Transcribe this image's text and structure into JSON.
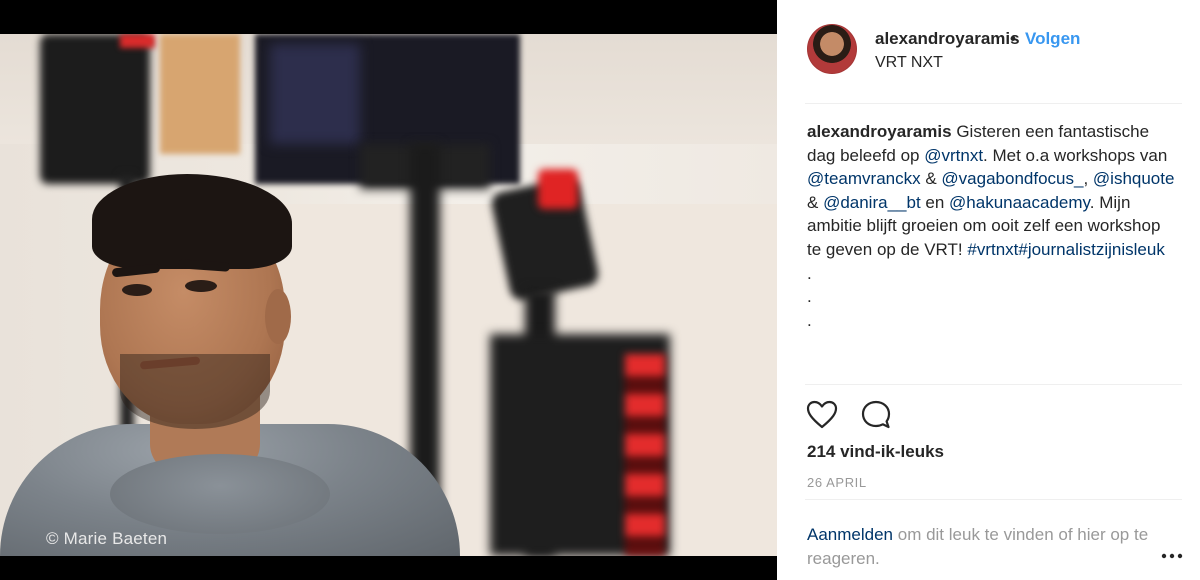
{
  "photo": {
    "credit": "© Marie Baeten"
  },
  "header": {
    "username": "alexandroyaramis",
    "separator": "•",
    "follow_label": "Volgen",
    "location": "VRT NXT",
    "avatar_icon": "user-avatar"
  },
  "caption": {
    "username": "alexandroyaramis",
    "parts": [
      " Gisteren een fantastische dag beleefd op ",
      "@vrtnxt",
      ". Met o.a workshops van ",
      "@teamvranckx",
      " & ",
      "@vagabondfocus_",
      ", ",
      "@ishquote",
      " & ",
      "@danira__bt",
      " en ",
      "@hakunaacademy",
      ". Mijn ambitie blijft groeien om ooit zelf een workshop te geven op de VRT! ",
      "#vrtnxt#journalistzijnisleuk"
    ],
    "dots": [
      ".",
      ".",
      "."
    ]
  },
  "actions": {
    "like_icon": "heart-icon",
    "comment_icon": "comment-icon",
    "more_icon": "more-icon"
  },
  "likes_label": "214 vind-ik-leuks",
  "date_label": "26 APRIL",
  "login": {
    "link_label": "Aanmelden",
    "rest_label": " om dit leuk te vinden of hier op te reageren."
  },
  "colors": {
    "accent": "#3897f0",
    "link": "#003569",
    "muted": "#999999",
    "text": "#262626"
  }
}
